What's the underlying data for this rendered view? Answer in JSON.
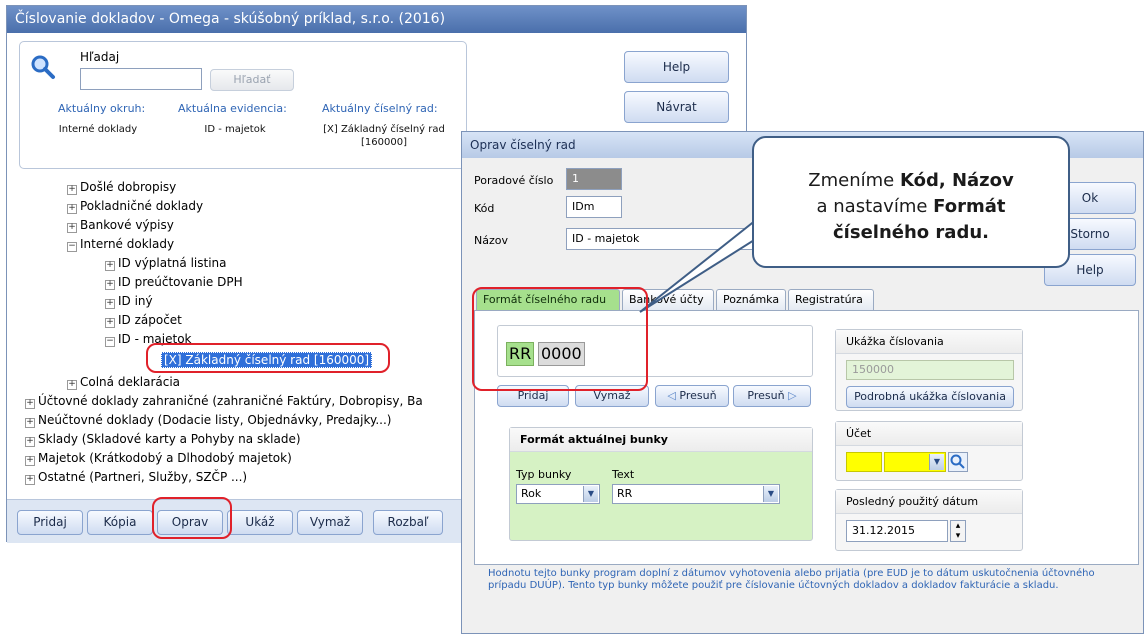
{
  "main_window": {
    "title": "Číslovanie dokladov - Omega - skúšobný príklad, s.r.o. (2016)",
    "search": {
      "label": "Hľadaj",
      "value": "",
      "button": "Hľadať"
    },
    "info": {
      "okruh_label": "Aktuálny okruh:",
      "okruh_value": "Interné doklady",
      "evidencia_label": "Aktuálna evidencia:",
      "evidencia_value": "ID - majetok",
      "rad_label": "Aktuálny číselný rad:",
      "rad_value_line1": "[X] Základný číselný rad",
      "rad_value_line2": "[160000]"
    },
    "buttons": {
      "help": "Help",
      "navrat": "Návrat"
    },
    "tree": [
      "Došlé dobropisy",
      "Pokladničné doklady",
      "Bankové výpisy",
      "Interné doklady",
      "ID výplatná listina",
      "ID preúčtovanie DPH",
      "ID iný",
      "ID zápočet",
      "ID - majetok",
      "[X] Základný číselný rad [160000]",
      "Colná deklarácia",
      "Účtovné doklady zahraničné (zahraničné Faktúry, Dobropisy, Ba",
      "Neúčtovné doklady (Dodacie listy, Objednávky, Predajky...)",
      "Sklady (Skladové karty a Pohyby na sklade)",
      "Majetok (Krátkodobý a Dlhodobý majetok)",
      "Ostatné (Partneri, Služby, SZČP ...)"
    ],
    "bottom_buttons": {
      "pridaj": "Pridaj",
      "kopia": "Kópia",
      "oprav": "Oprav",
      "ukaz": "Ukáž",
      "vymaz": "Vymaž",
      "rozbal": "Rozbaľ"
    }
  },
  "dialog": {
    "title": "Oprav číselný rad",
    "poradove_label": "Poradové číslo",
    "poradove_value": "1",
    "kod_label": "Kód",
    "kod_value": "IDm",
    "nazov_label": "Názov",
    "nazov_value": "ID - majetok",
    "buttons": {
      "ok": "Ok",
      "storno": "Storno",
      "help": "Help"
    },
    "tabs": [
      "Formát číselného radu",
      "Bankové účty",
      "Poznámka",
      "Registratúra"
    ],
    "format_cells": [
      "RR",
      "0000"
    ],
    "cell_buttons": {
      "pridaj": "Pridaj",
      "vymaz": "Vymaž",
      "presun_left": "Presuň",
      "presun_right": "Presuň"
    },
    "ukazka": {
      "header": "Ukážka číslovania",
      "value": "150000",
      "button": "Podrobná ukážka číslovania"
    },
    "aktualna_bunka": {
      "header": "Formát aktuálnej bunky",
      "typ_label": "Typ bunky",
      "typ_value": "Rok",
      "text_label": "Text",
      "text_value": "RR"
    },
    "ucet": {
      "header": "Účet"
    },
    "posledny": {
      "header": "Posledný použitý dátum",
      "value": "31.12.2015"
    },
    "note": "Hodnotu tejto bunky program doplní z dátumov vyhotovenia alebo prijatia (pre EUD je to dátum uskutočnenia účtovného prípadu DUÚP). Tento typ bunky môžete použiť pre číslovanie účtovných dokladov a dokladov fakturácie a skladu."
  },
  "callout": {
    "line1_pre": "Zmeníme ",
    "line1_bold": "Kód, Názov",
    "line2_pre": "a nastavíme ",
    "line2_bold": "Formát",
    "line3_bold": "číselného radu."
  },
  "colors": {
    "title_blue": "#4a6fab",
    "tab_active_green": "#a6e08d",
    "highlight_red": "#e0212a",
    "info_blue": "#2f65b5",
    "account_yellow": "#ffff00",
    "selection_blue": "#2f6fd9"
  }
}
